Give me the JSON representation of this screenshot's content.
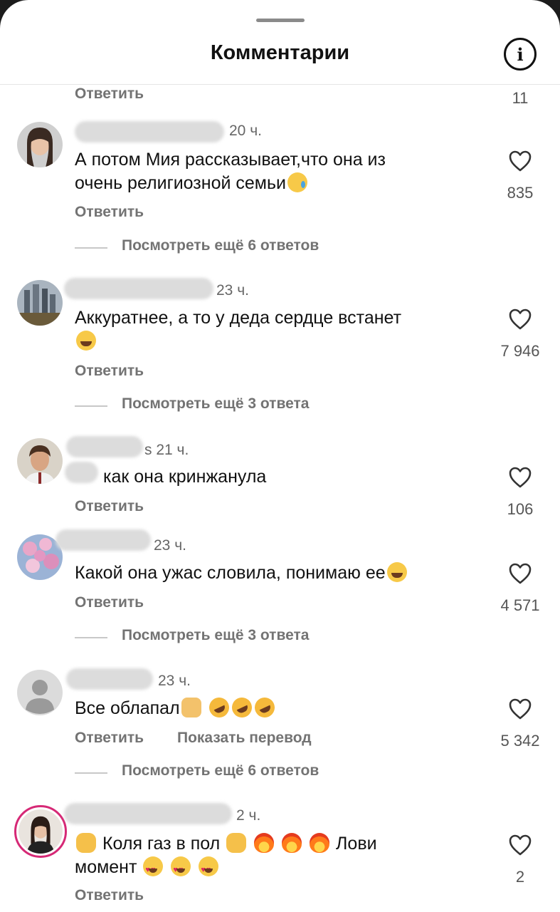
{
  "header": {
    "title": "Комментарии",
    "info_icon": "info-icon",
    "info_glyph": "i"
  },
  "top_stub": {
    "reply_label": "Ответить",
    "likes": "11"
  },
  "comments": [
    {
      "time": "20 ч.",
      "text": "А потом Мия рассказывает,что она из очень религиозной семьи",
      "text_line1": "А потом Мия рассказывает,что она из",
      "text_line2": "очень религиозной семьи",
      "emoji": [
        "cry-emoji"
      ],
      "reply_label": "Ответить",
      "likes": "835",
      "view_replies": "Посмотреть ещё 6 ответов"
    },
    {
      "time": "23 ч.",
      "text": "Аккуратнее, а то у деда сердце встанет",
      "emoji": [
        "laugh-emoji"
      ],
      "reply_label": "Ответить",
      "likes": "7 946",
      "view_replies": "Посмотреть ещё 3 ответа"
    },
    {
      "name_tail": "s",
      "time": "21 ч.",
      "text": "как она кринжанула",
      "reply_label": "Ответить",
      "likes": "106"
    },
    {
      "time": "23 ч.",
      "text": "Какой она ужас словила, понимаю ее",
      "emoji": [
        "laugh-emoji"
      ],
      "reply_label": "Ответить",
      "likes": "4 571",
      "view_replies": "Посмотреть ещё 3 ответа"
    },
    {
      "time": "23 ч.",
      "text": "Все облапал",
      "emoji": [
        "facepalm-emoji",
        "rofl-emoji",
        "rofl-emoji",
        "rofl-emoji"
      ],
      "reply_label": "Ответить",
      "translate_label": "Показать перевод",
      "likes": "5 342",
      "view_replies": "Посмотреть ещё 6 ответов"
    },
    {
      "time": "2 ч.",
      "text_part1": "Коля газ в пол",
      "text_part2": "Лови",
      "text_part3": "момент",
      "emoji": [
        "raising-hands-emoji",
        "clap-emoji",
        "fire-emoji",
        "fire-emoji",
        "fire-emoji",
        "heart-eyes-emoji",
        "heart-eyes-emoji",
        "heart-eyes-emoji"
      ],
      "reply_label": "Ответить",
      "likes": "2"
    }
  ],
  "colors": {
    "text": "#111111",
    "secondary": "#737373",
    "story_ring": "#d62976",
    "background": "#ffffff"
  }
}
